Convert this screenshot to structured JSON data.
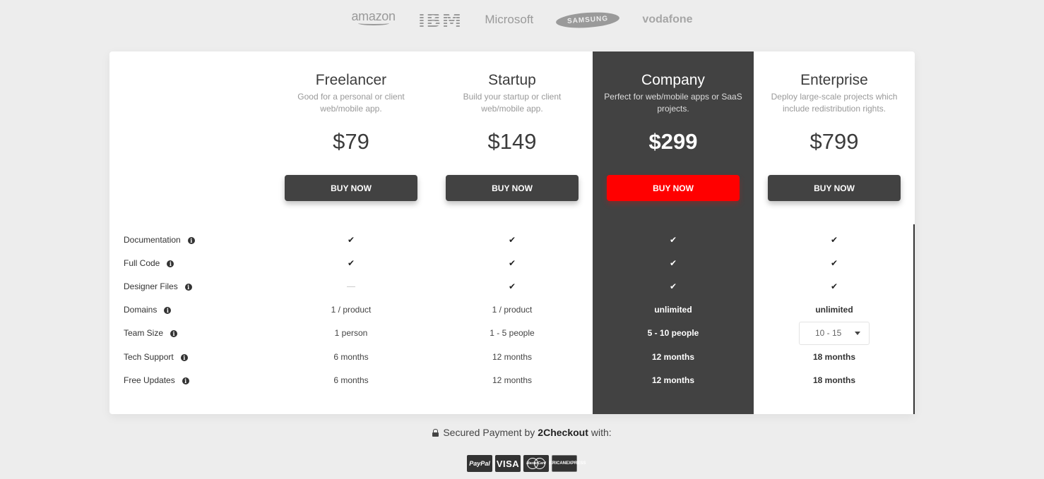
{
  "logos": [
    {
      "name": "amazon",
      "text": "amazon"
    },
    {
      "name": "ibm",
      "text": "IBM"
    },
    {
      "name": "microsoft",
      "text": "Microsoft"
    },
    {
      "name": "samsung",
      "text": "SAMSUNG"
    },
    {
      "name": "vodafone",
      "text": "vodafone"
    }
  ],
  "plans": [
    {
      "name": "Freelancer",
      "desc": "Good for a personal or client web/mobile app.",
      "price": "$79",
      "button": "BUY NOW"
    },
    {
      "name": "Startup",
      "desc": "Build your startup or client web/mobile app.",
      "price": "$149",
      "button": "BUY NOW"
    },
    {
      "name": "Company",
      "desc": "Perfect for web/mobile apps or SaaS projects.",
      "price": "$299",
      "button": "BUY NOW"
    },
    {
      "name": "Enterprise",
      "desc": "Deploy large-scale projects which include redistribution rights.",
      "price": "$799",
      "button": "BUY NOW"
    }
  ],
  "features": [
    {
      "label": "Documentation",
      "values": [
        "check",
        "check",
        "check",
        "check"
      ]
    },
    {
      "label": "Full Code",
      "values": [
        "check",
        "check",
        "check",
        "check"
      ]
    },
    {
      "label": "Designer Files",
      "values": [
        "dash",
        "check",
        "check",
        "check"
      ]
    },
    {
      "label": "Domains",
      "values": [
        "1 / product",
        "1 / product",
        "unlimited",
        "unlimited"
      ]
    },
    {
      "label": "Team Size",
      "values": [
        "1 person",
        "1 - 5 people",
        "5 - 10 people",
        "10 - 15"
      ]
    },
    {
      "label": "Tech Support",
      "values": [
        "6 months",
        "12 months",
        "12 months",
        "18 months"
      ]
    },
    {
      "label": "Free Updates",
      "values": [
        "6 months",
        "12 months",
        "12 months",
        "18 months"
      ]
    }
  ],
  "team_size_select": {
    "selected": "10 - 15"
  },
  "glyphs": {
    "check": "✔",
    "info": "i"
  },
  "footer": {
    "secure_prefix": "Secured Payment by",
    "secure_brand": "2Checkout",
    "secure_suffix": "with:",
    "payment_methods": {
      "paypal": "PayPal",
      "visa": "VISA",
      "mastercard": "MasterCard",
      "amex_line1": "AMERICAN",
      "amex_line2": "EXPRESS"
    }
  },
  "colors": {
    "highlight_bg": "#424242",
    "highlight_button": "#ff0000",
    "button": "#424242"
  }
}
